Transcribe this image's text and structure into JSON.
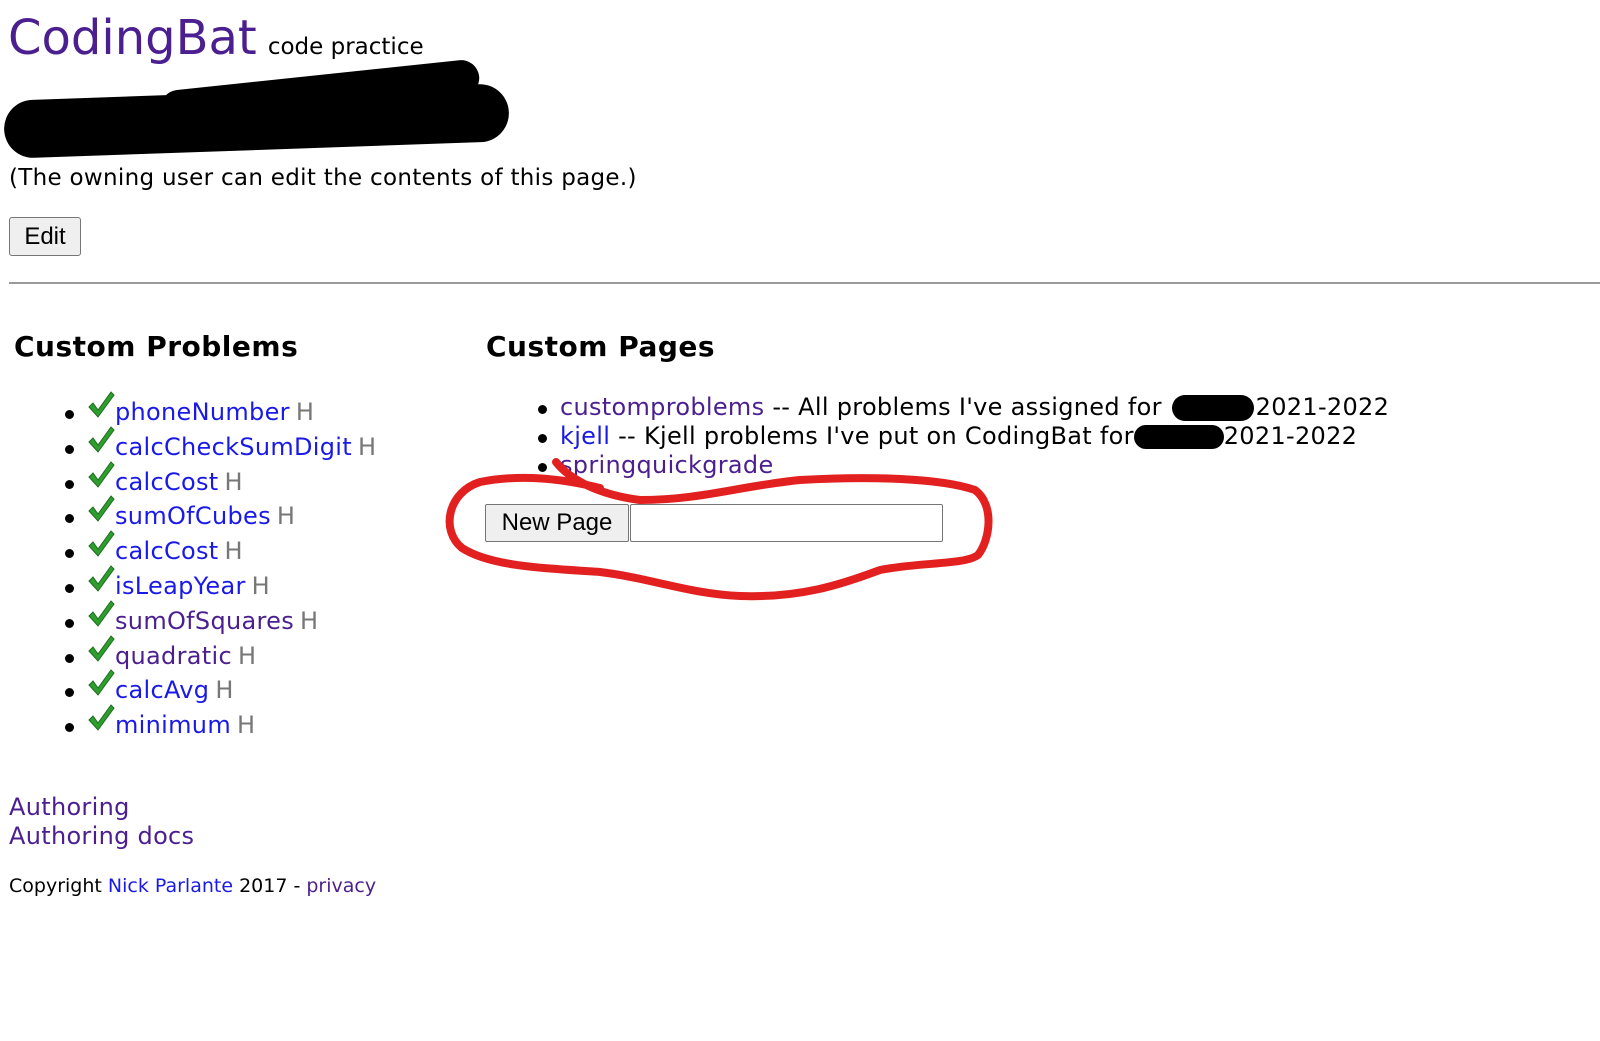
{
  "header": {
    "brand": "CodingBat",
    "tagline": "code practice"
  },
  "owner_note": "(The owning user can edit the contents of this page.)",
  "edit_button": "Edit",
  "custom_problems": {
    "title": "Custom Problems",
    "items": [
      {
        "name": "phoneNumber",
        "flag": "H",
        "done": true
      },
      {
        "name": "calcCheckSumDigit",
        "flag": "H",
        "done": true
      },
      {
        "name": "calcCost",
        "flag": "H",
        "done": true
      },
      {
        "name": "sumOfCubes",
        "flag": "H",
        "done": true
      },
      {
        "name": "calcCost",
        "flag": "H",
        "done": true
      },
      {
        "name": "isLeapYear",
        "flag": "H",
        "done": true
      },
      {
        "name": "sumOfSquares",
        "flag": "H",
        "done": true
      },
      {
        "name": "quadratic",
        "flag": "H",
        "done": true
      },
      {
        "name": "calcAvg",
        "flag": "H",
        "done": true
      },
      {
        "name": "minimum",
        "flag": "H",
        "done": true
      }
    ]
  },
  "custom_pages": {
    "title": "Custom Pages",
    "items": [
      {
        "name": "customproblems",
        "desc_before": " -- All problems I've assigned for ",
        "desc_after": "2021-2022"
      },
      {
        "name": "kjell",
        "desc_before": " -- Kjell problems I've put on CodingBat for ",
        "desc_after": "2021-2022"
      },
      {
        "name": "springquickgrade",
        "desc_before": "",
        "desc_after": ""
      }
    ],
    "new_page_button": "New Page",
    "new_page_input_value": ""
  },
  "footer": {
    "authoring": "Authoring",
    "authoring_docs": "Authoring docs",
    "copyright_prefix": "Copyright ",
    "author": "Nick Parlante",
    "year_sep": " 2017 - ",
    "privacy": "privacy"
  },
  "colors": {
    "visited_link": "#4b1f8f",
    "link": "#1a1ae8",
    "check": "#2e9e2e",
    "annotation": "#e32020"
  },
  "icons": {
    "check": "checkmark-icon"
  }
}
